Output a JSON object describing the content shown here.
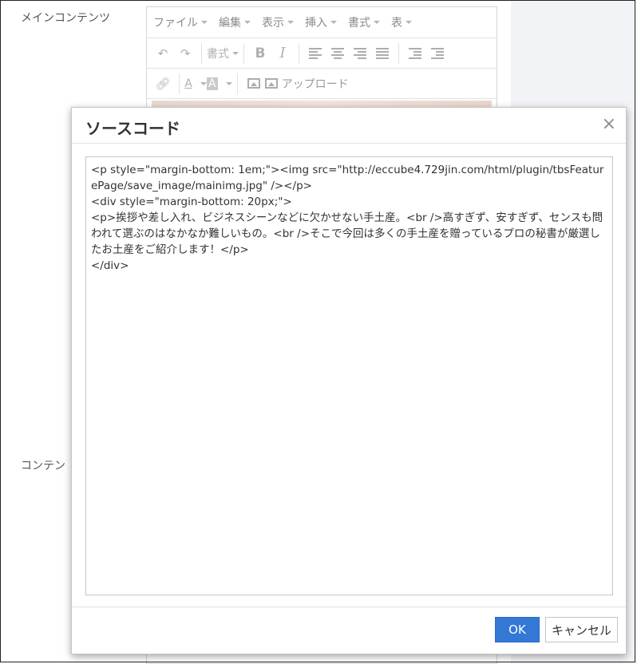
{
  "labels": {
    "main_content": "メインコンテンツ",
    "content": "コンテン"
  },
  "editor": {
    "menubar": [
      {
        "label": "ファイル"
      },
      {
        "label": "編集"
      },
      {
        "label": "表示"
      },
      {
        "label": "挿入"
      },
      {
        "label": "書式"
      },
      {
        "label": "表"
      }
    ],
    "toolbar": {
      "format_label": "書式",
      "bold": "B",
      "italic": "I",
      "text_color": "A",
      "bg_color": "A",
      "upload_label": "アップロード"
    }
  },
  "dialog": {
    "title": "ソースコード",
    "close_symbol": "×",
    "source_code": "<p style=\"margin-bottom: 1em;\"><img src=\"http://eccube4.729jin.com/html/plugin/tbsFeaturePage/save_image/mainimg.jpg\" /></p>\n<div style=\"margin-bottom: 20px;\">\n<p>挨拶や差し入れ、ビジネスシーンなどに欠かせない手土産。<br />高すぎず、安すぎず、センスも問われて選ぶのはなかなか難しいもの。<br />そこで今回は多くの手土産を贈っているプロの秘書が厳選したお土産をご紹介します！</p>\n</div>",
    "ok_label": "OK",
    "cancel_label": "キャンセル"
  },
  "colors": {
    "primary": "#3478d6",
    "side_panel": "#f2f3f6"
  }
}
